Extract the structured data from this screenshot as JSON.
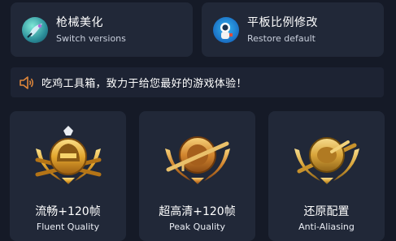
{
  "top_cards": [
    {
      "title": "枪械美化",
      "subtitle": "Switch versions",
      "icon": "gun-skin-icon"
    },
    {
      "title": "平板比例修改",
      "subtitle": "Restore default",
      "icon": "astronaut-icon"
    }
  ],
  "notice": {
    "text": "吃鸡工具箱，致力于给您最好的游戏体验！",
    "icon": "speaker-icon"
  },
  "modes": [
    {
      "title": "流畅+120帧",
      "subtitle": "Fluent Quality",
      "icon": "helmet-badge-icon"
    },
    {
      "title": "超高清+120帧",
      "subtitle": "Peak Quality",
      "icon": "rifle-badge-icon"
    },
    {
      "title": "还原配置",
      "subtitle": "Anti-Aliasing",
      "icon": "pan-badge-icon"
    }
  ],
  "colors": {
    "background": "#151a27",
    "card": "#212838",
    "gold": "#e3b13a",
    "notice_icon": "#e0873a"
  }
}
